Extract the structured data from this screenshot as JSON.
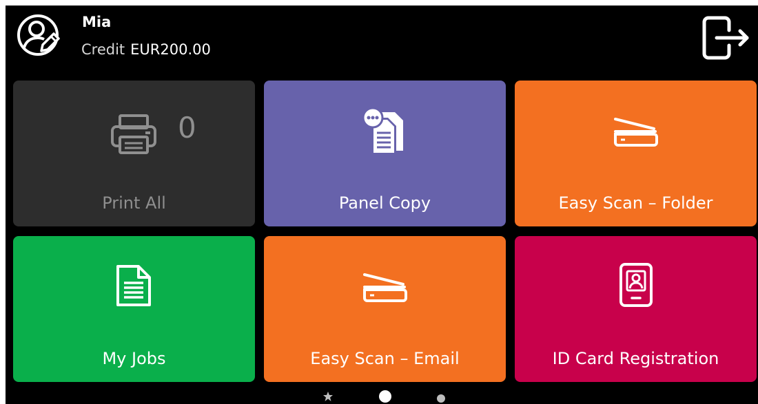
{
  "user": {
    "name": "Mia",
    "credit_label": "Credit",
    "credit_value": "EUR200.00",
    "avatar_icon": "user-edit-icon"
  },
  "header": {
    "logout_icon": "logout-icon"
  },
  "tiles": [
    {
      "label": "Print All",
      "icon": "printer-icon",
      "count": "0",
      "color": "#2d2d2d"
    },
    {
      "label": "Panel Copy",
      "icon": "copy-documents-icon",
      "color": "#6762ab"
    },
    {
      "label": "Easy Scan – Folder",
      "icon": "scanner-icon",
      "color": "#f37021"
    },
    {
      "label": "My Jobs",
      "icon": "document-icon",
      "color": "#0aaf4b"
    },
    {
      "label": "Easy Scan – Email",
      "icon": "scanner-icon",
      "color": "#f37021"
    },
    {
      "label": "ID Card Registration",
      "icon": "id-card-icon",
      "color": "#c8014b"
    }
  ],
  "pager": {
    "pages": 3,
    "current": 2,
    "first_page_icon": "star-icon"
  }
}
